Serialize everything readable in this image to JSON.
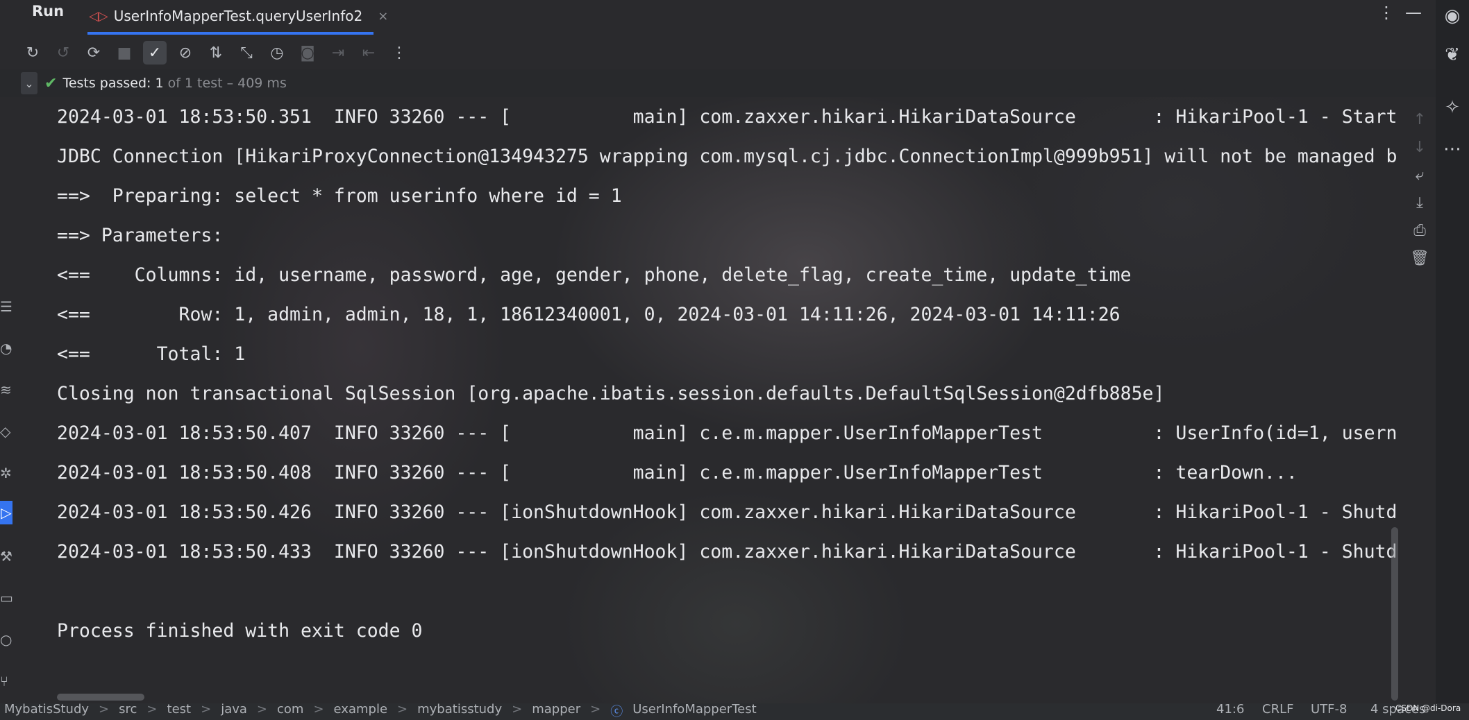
{
  "run_panel": {
    "title": "Run",
    "tab_label": "UserInfoMapperTest.queryUserInfo2",
    "tab_icon": "test-run-icon",
    "tab_close": "×"
  },
  "window_controls": {
    "more": "⋮",
    "minimize": "—"
  },
  "test_status": {
    "label": "Tests passed: 1",
    "detail": "of 1 test – 409 ms"
  },
  "console_lines": [
    "2024-03-01 18:53:50.351  INFO 33260 --- [           main] com.zaxxer.hikari.HikariDataSource       : HikariPool-1 - Start",
    "JDBC Connection [HikariProxyConnection@134943275 wrapping com.mysql.cj.jdbc.ConnectionImpl@999b951] will not be managed b",
    "==>  Preparing: select * from userinfo where id = 1",
    "==> Parameters: ",
    "<==    Columns: id, username, password, age, gender, phone, delete_flag, create_time, update_time",
    "<==        Row: 1, admin, admin, 18, 1, 18612340001, 0, 2024-03-01 14:11:26, 2024-03-01 14:11:26",
    "<==      Total: 1",
    "Closing non transactional SqlSession [org.apache.ibatis.session.defaults.DefaultSqlSession@2dfb885e]",
    "2024-03-01 18:53:50.407  INFO 33260 --- [           main] c.e.m.mapper.UserInfoMapperTest          : UserInfo(id=1, usern",
    "2024-03-01 18:53:50.408  INFO 33260 --- [           main] c.e.m.mapper.UserInfoMapperTest          : tearDown...",
    "2024-03-01 18:53:50.426  INFO 33260 --- [ionShutdownHook] com.zaxxer.hikari.HikariDataSource       : HikariPool-1 - Shutd",
    "2024-03-01 18:53:50.433  INFO 33260 --- [ionShutdownHook] com.zaxxer.hikari.HikariDataSource       : HikariPool-1 - Shutd",
    "",
    "Process finished with exit code 0"
  ],
  "breadcrumbs": [
    "MybatisStudy",
    "src",
    "test",
    "java",
    "com",
    "example",
    "mybatisstudy",
    "mapper",
    "UserInfoMapperTest"
  ],
  "breadcrumb_separator": ">",
  "status_bar": {
    "position": "41:6",
    "line_ending": "CRLF",
    "encoding": "UTF-8",
    "indent": "4 spaces"
  },
  "watermark": "CSDN @di-Dora",
  "icons": {
    "toolbar": [
      "rerun-icon",
      "rerun-failed-icon",
      "toggle-auto-test-icon",
      "stop-icon",
      "show-passed-icon",
      "show-ignored-icon",
      "sort-alphabetically-icon",
      "sort-by-duration-icon",
      "history-icon",
      "camera-icon",
      "export-icon",
      "import-icon",
      "more-icon"
    ],
    "console_side": [
      "scroll-up-icon",
      "scroll-down-icon",
      "soft-wrap-icon",
      "scroll-to-end-icon",
      "print-icon",
      "clear-icon"
    ],
    "right_sidebar": [
      "notifications-icon",
      "database-icon",
      "ai-assistant-icon",
      "more-icon"
    ]
  }
}
